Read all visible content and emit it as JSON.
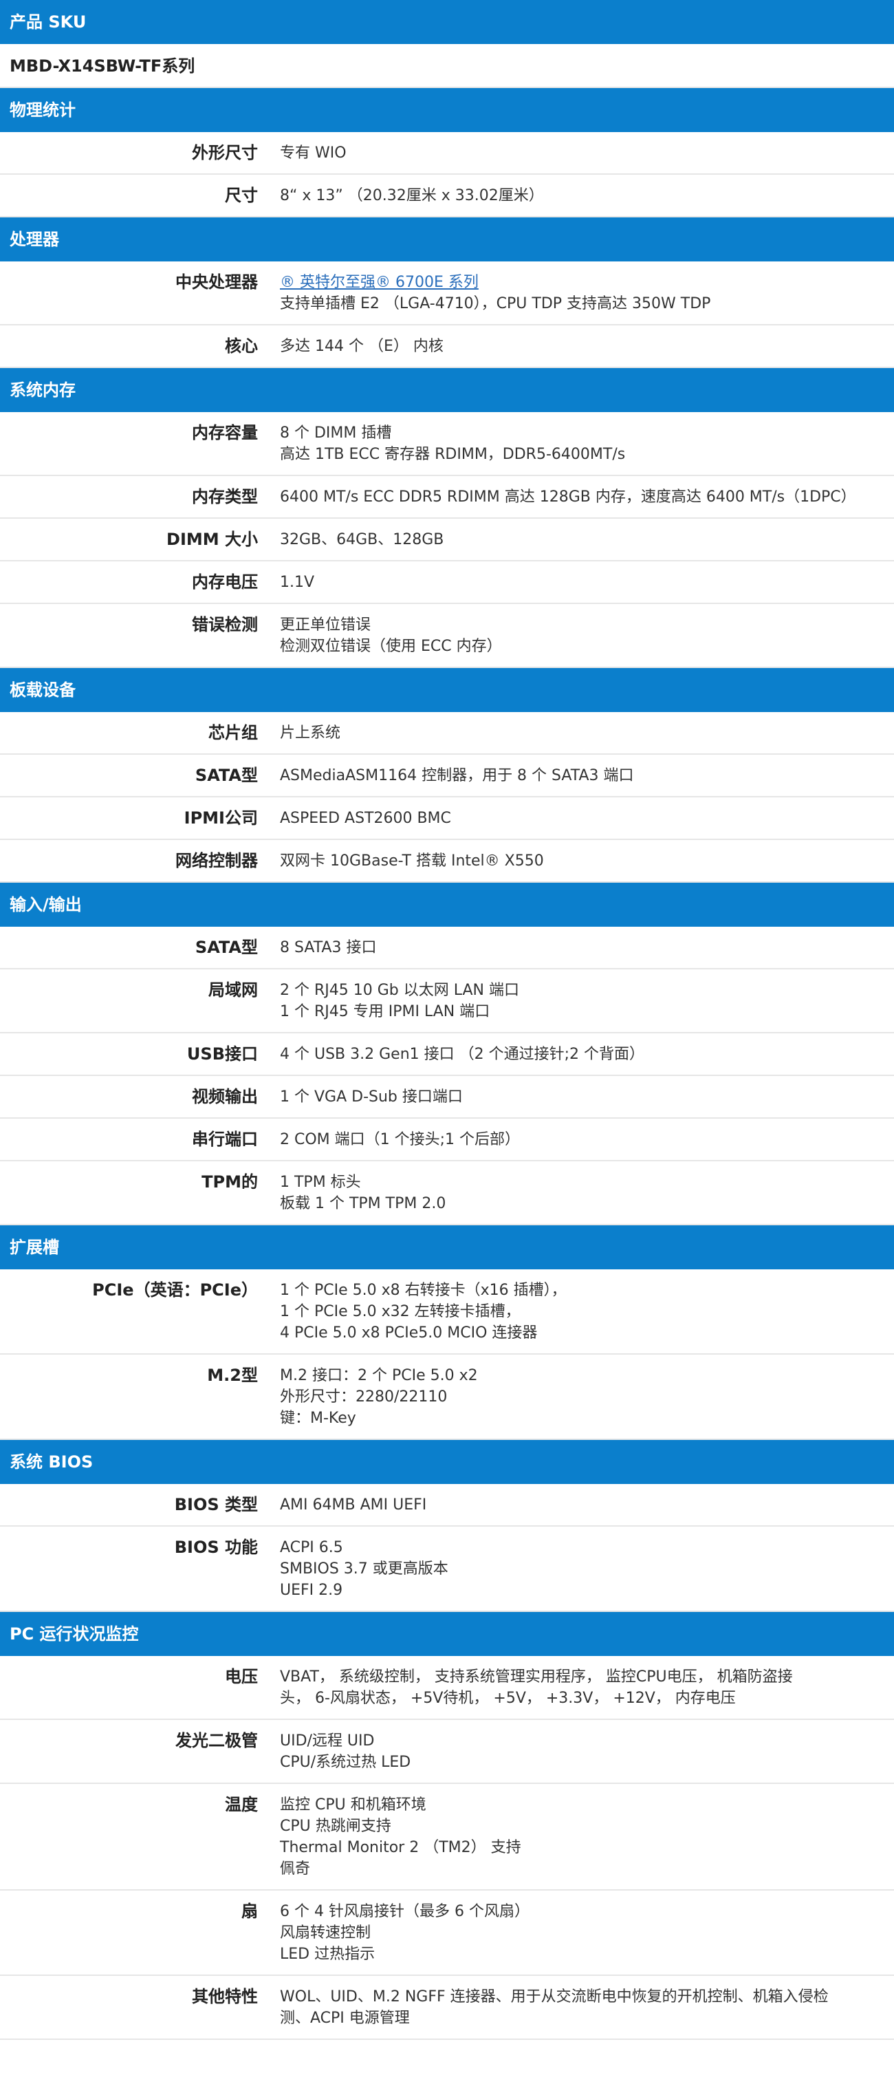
{
  "sections": [
    {
      "title": "产品 SKU",
      "sku": "MBD-X14SBW-TF系列",
      "rows": []
    },
    {
      "title": "物理统计",
      "rows": [
        {
          "label": "外形尺寸",
          "lines": [
            "专有 WIO"
          ]
        },
        {
          "label": "尺寸",
          "lines": [
            "8“ x 13” （20.32厘米 x 33.02厘米）"
          ]
        }
      ]
    },
    {
      "title": "处理器",
      "rows": [
        {
          "label": "中央处理器",
          "link": "® 英特尔至强® 6700E 系列",
          "lines": [
            "支持单插槽 E2 （LGA-4710），CPU TDP 支持高达 350W TDP"
          ]
        },
        {
          "label": "核心",
          "lines": [
            "多达 144 个 （E） 内核"
          ]
        }
      ]
    },
    {
      "title": "系统内存",
      "rows": [
        {
          "label": "内存容量",
          "lines": [
            "8 个 DIMM 插槽",
            "高达 1TB ECC 寄存器 RDIMM，DDR5-6400MT/s"
          ]
        },
        {
          "label": "内存类型",
          "lines": [
            "6400 MT/s ECC DDR5 RDIMM 高达 128GB 内存，速度高达 6400 MT/s（1DPC）"
          ]
        },
        {
          "label": "DIMM 大小",
          "lines": [
            "32GB、64GB、128GB"
          ]
        },
        {
          "label": "内存电压",
          "lines": [
            "1.1V"
          ]
        },
        {
          "label": "错误检测",
          "lines": [
            "更正单位错误",
            "检测双位错误（使用 ECC 内存）"
          ]
        }
      ]
    },
    {
      "title": "板载设备",
      "rows": [
        {
          "label": "芯片组",
          "lines": [
            "片上系统"
          ]
        },
        {
          "label": "SATA型",
          "lines": [
            "ASMediaASM1164 控制器，用于 8 个 SATA3 端口"
          ]
        },
        {
          "label": "IPMI公司",
          "lines": [
            "ASPEED AST2600 BMC"
          ]
        },
        {
          "label": "网络控制器",
          "lines": [
            "双网卡 10GBase-T 搭载 Intel® X550"
          ]
        }
      ]
    },
    {
      "title": "输入/输出",
      "rows": [
        {
          "label": "SATA型",
          "lines": [
            "8 SATA3 接口"
          ]
        },
        {
          "label": "局域网",
          "lines": [
            "2 个 RJ45 10 Gb 以太网 LAN 端口",
            "1 个 RJ45 专用 IPMI LAN 端口"
          ]
        },
        {
          "label": "USB接口",
          "lines": [
            "4 个 USB 3.2 Gen1 接口 （2 个通过接针;2 个背面）"
          ]
        },
        {
          "label": "视频输出",
          "lines": [
            "1 个 VGA D-Sub 接口端口"
          ]
        },
        {
          "label": "串行端口",
          "lines": [
            "2 COM 端口（1 个接头;1 个后部）"
          ]
        },
        {
          "label": "TPM的",
          "lines": [
            "1 TPM 标头",
            "板载 1 个 TPM TPM 2.0"
          ]
        }
      ]
    },
    {
      "title": "扩展槽",
      "rows": [
        {
          "label": "PCIe（英语：PCIe）",
          "lines": [
            "1 个 PCIe 5.0 x8 右转接卡（x16 插槽），",
            "1 个 PCIe 5.0 x32 左转接卡插槽，",
            "4 PCIe 5.0 x8 PCIe5.0 MCIO 连接器"
          ]
        },
        {
          "label": "M.2型",
          "lines": [
            "M.2 接口：2 个 PCIe 5.0 x2",
            "外形尺寸：2280/22110",
            "键：M-Key"
          ]
        }
      ]
    },
    {
      "title": "系统 BIOS",
      "rows": [
        {
          "label": "BIOS 类型",
          "lines": [
            "AMI 64MB AMI UEFI"
          ]
        },
        {
          "label": "BIOS 功能",
          "lines": [
            "ACPI 6.5",
            "SMBIOS 3.7 或更高版本",
            "UEFI 2.9"
          ]
        }
      ]
    },
    {
      "title": "PC 运行状况监控",
      "rows": [
        {
          "label": "电压",
          "lines": [
            "VBAT， 系统级控制， 支持系统管理实用程序， 监控CPU电压， 机箱防盗接",
            "头， 6-风扇状态， +5V待机， +5V， +3.3V， +12V， 内存电压"
          ]
        },
        {
          "label": "发光二极管",
          "lines": [
            "UID/远程 UID",
            "CPU/系统过热 LED"
          ]
        },
        {
          "label": "温度",
          "lines": [
            "监控 CPU 和机箱环境",
            "CPU 热跳闸支持",
            "Thermal Monitor 2 （TM2） 支持",
            "佩奇"
          ]
        },
        {
          "label": "扇",
          "lines": [
            "6 个 4 针风扇接针（最多 6 个风扇）",
            "风扇转速控制",
            "LED 过热指示"
          ]
        },
        {
          "label": "其他特性",
          "lines": [
            "WOL、UID、M.2 NGFF 连接器、用于从交流断电中恢复的开机控制、机箱入侵检",
            "测、ACPI 电源管理"
          ]
        }
      ]
    }
  ]
}
